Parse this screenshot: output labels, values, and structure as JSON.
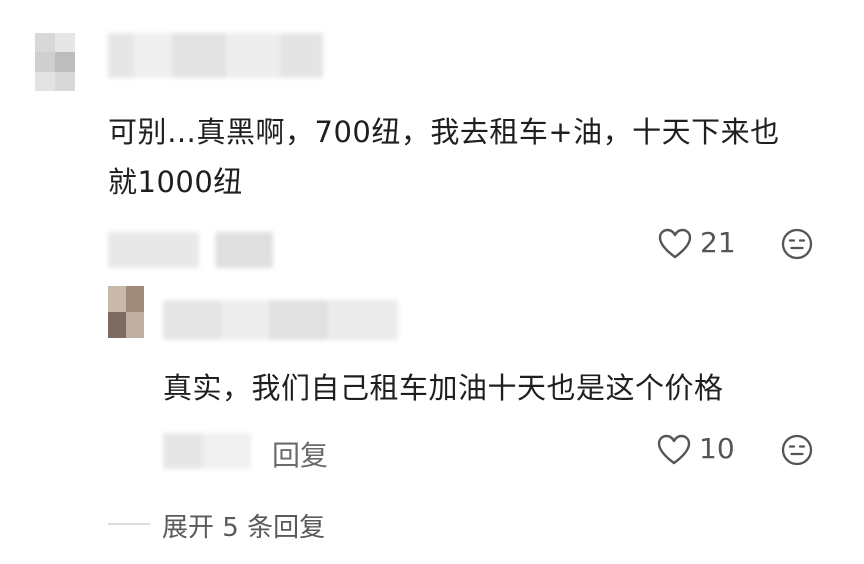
{
  "comment": {
    "text": "可别…真黑啊，700纽，我去租车+油，十天下来也就1000纽",
    "line1": "可别…真黑啊，700纽，我去租车+油，十天下来也",
    "line2": "就1000纽",
    "likes": "21"
  },
  "reply": {
    "text": "真实，我们自己租车加油十天也是这个价格",
    "reply_label": "回复",
    "likes": "10"
  },
  "expand": {
    "label": "展开 5 条回复"
  },
  "icons": {
    "heart": "heart-icon",
    "neutral_face": "neutral-face-icon"
  },
  "colors": {
    "text": "#1f1f1f",
    "secondary": "#6b6b6b",
    "icon": "#555555"
  }
}
